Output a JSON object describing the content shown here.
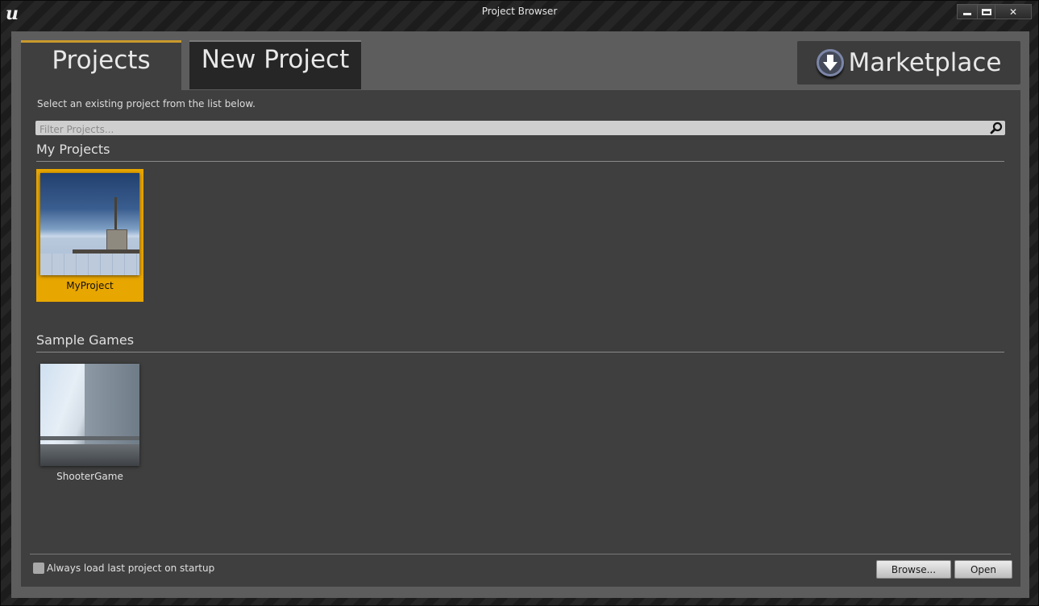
{
  "window": {
    "title": "Project Browser",
    "logo": "unreal-engine-logo",
    "controls": {
      "minimize": "minimize",
      "maximize": "maximize",
      "close": "✕"
    }
  },
  "tabs": [
    {
      "label": "Projects",
      "active": true
    },
    {
      "label": "New Project",
      "active": false
    }
  ],
  "marketplace": {
    "label": "Marketplace",
    "icon": "download-arrow-icon"
  },
  "instruction": "Select an existing project from the list below.",
  "filter": {
    "placeholder": "Filter Projects...",
    "value": "",
    "icon": "search-icon"
  },
  "sections": [
    {
      "title": "My Projects",
      "projects": [
        {
          "name": "MyProject",
          "selected": true
        }
      ]
    },
    {
      "title": "Sample Games",
      "projects": [
        {
          "name": "ShooterGame",
          "selected": false
        }
      ]
    }
  ],
  "footer": {
    "always_load_label": "Always load last project on startup",
    "always_load_checked": false,
    "browse_label": "Browse...",
    "open_label": "Open"
  },
  "colors": {
    "accent": "#e8a600",
    "tab_underline": "#c99a2c",
    "panel": "#3f3f3f"
  }
}
